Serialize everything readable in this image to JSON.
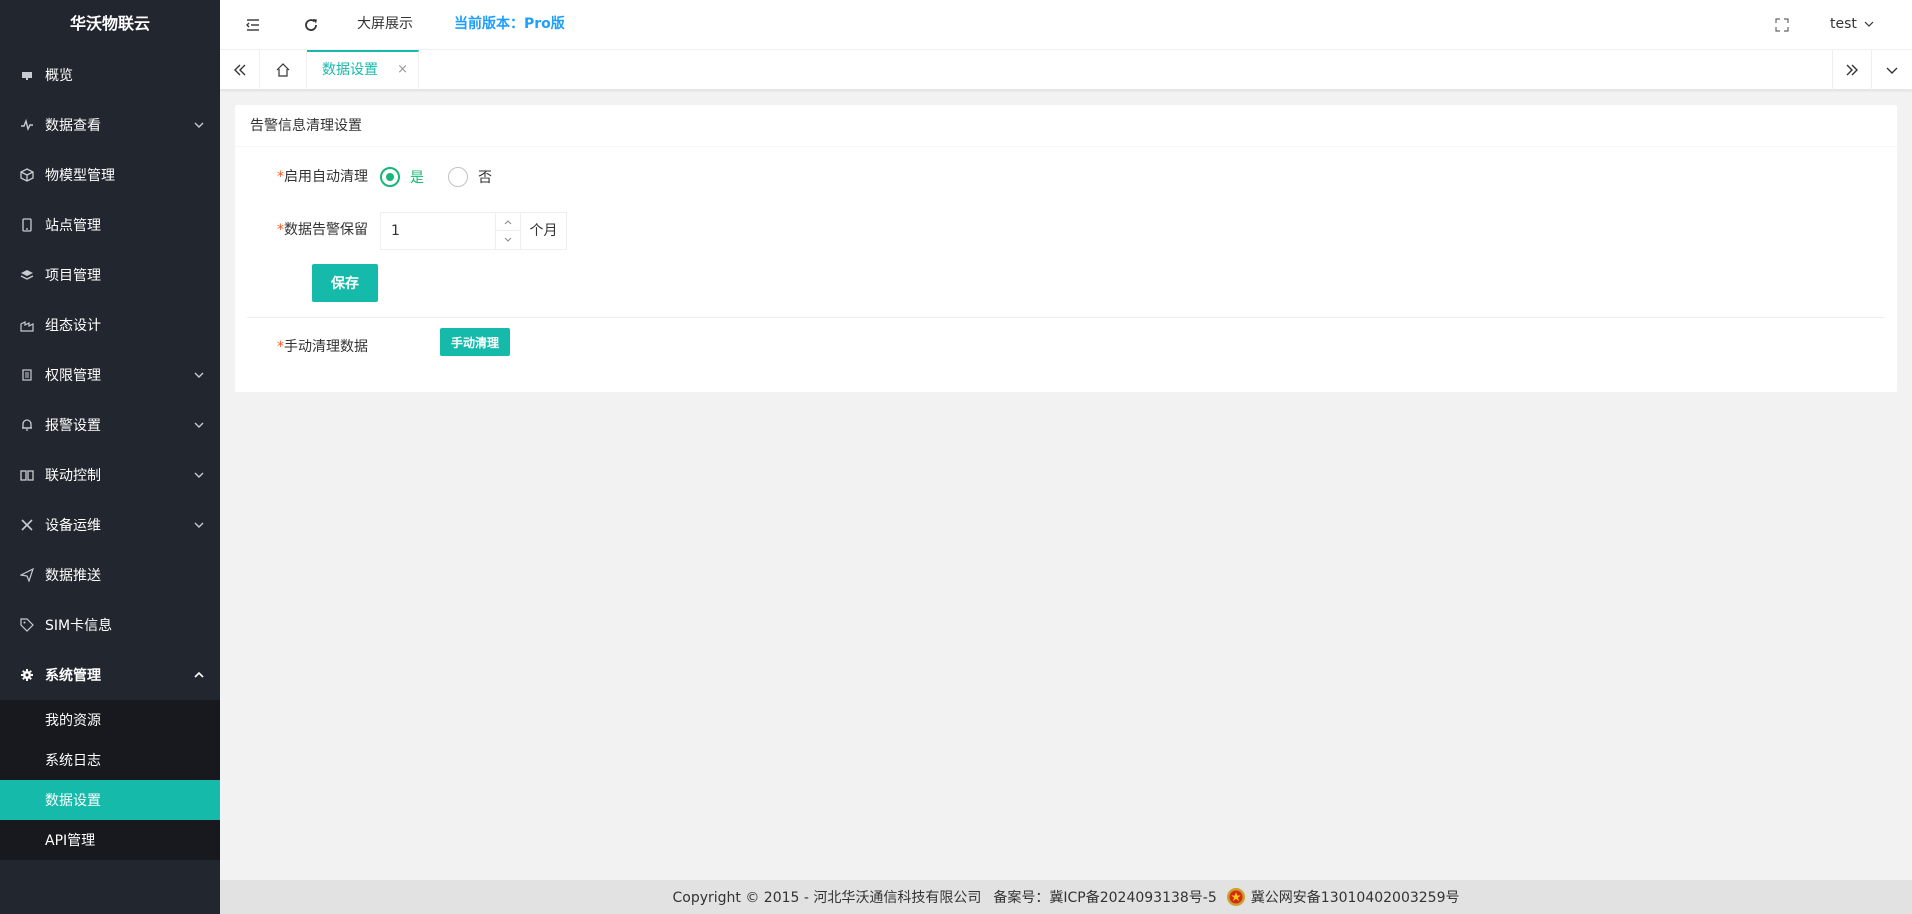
{
  "sidebar": {
    "logo": "华沃物联云",
    "items": [
      {
        "label": "概览",
        "icon": "monitor-icon",
        "has_children": false
      },
      {
        "label": "数据查看",
        "icon": "pulse-icon",
        "has_children": true
      },
      {
        "label": "物模型管理",
        "icon": "cube-icon",
        "has_children": false
      },
      {
        "label": "站点管理",
        "icon": "tablet-icon",
        "has_children": false
      },
      {
        "label": "项目管理",
        "icon": "layers-icon",
        "has_children": false
      },
      {
        "label": "组态设计",
        "icon": "factory-icon",
        "has_children": false
      },
      {
        "label": "权限管理",
        "icon": "document-icon",
        "has_children": true
      },
      {
        "label": "报警设置",
        "icon": "bell-icon",
        "has_children": true
      },
      {
        "label": "联动控制",
        "icon": "columns-icon",
        "has_children": true
      },
      {
        "label": "设备运维",
        "icon": "tools-icon",
        "has_children": true
      },
      {
        "label": "数据推送",
        "icon": "send-icon",
        "has_children": false
      },
      {
        "label": "SIM卡信息",
        "icon": "tag-icon",
        "has_children": false
      },
      {
        "label": "系统管理",
        "icon": "gear-icon",
        "has_children": true,
        "expanded": true
      }
    ],
    "submenu": [
      {
        "label": "我的资源",
        "active": false
      },
      {
        "label": "系统日志",
        "active": false
      },
      {
        "label": "数据设置",
        "active": true
      },
      {
        "label": "API管理",
        "active": false
      }
    ]
  },
  "header": {
    "bigscreen": "大屏展示",
    "version": "当前版本：Pro版",
    "user": "test"
  },
  "tabs": {
    "active_tab": "数据设置",
    "close_symbol": "×"
  },
  "card": {
    "title": "告警信息清理设置",
    "required_mark": "*",
    "auto_clean_label": "启用自动清理",
    "radio_yes": "是",
    "radio_no": "否",
    "selected": "是",
    "retain_label": "数据告警保留",
    "retain_value": "1",
    "retain_unit": "个月",
    "save_button": "保存",
    "manual_label": "手动清理数据",
    "manual_button": "手动清理"
  },
  "footer": {
    "copyright": "Copyright © 2015 - 河北华沃通信科技有限公司",
    "icp": "备案号：冀ICP备2024093138号-5",
    "police": "冀公网安备13010402003259号"
  },
  "colors": {
    "sidebar_bg": "#22262e",
    "submenu_bg": "#17191e",
    "accent": "#16baaa",
    "radio_green": "#16b777",
    "version_blue": "#1e9fff",
    "required_red": "#ff5722"
  }
}
